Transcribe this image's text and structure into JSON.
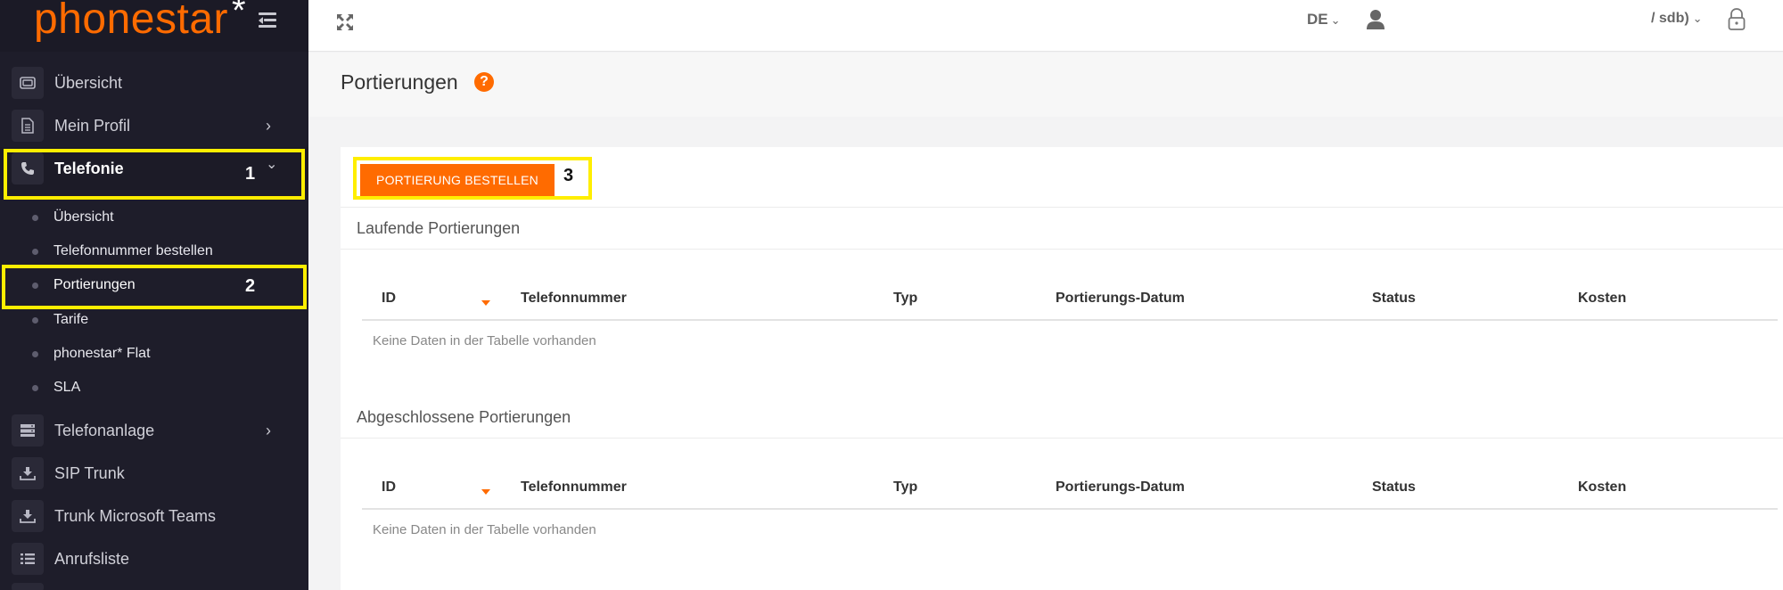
{
  "brand": {
    "logo_text": "phonestar",
    "logo_asterisk": "*"
  },
  "topbar": {
    "lang": "DE",
    "account": "/ sdb)",
    "caret": "⌄"
  },
  "sidebar": {
    "items": [
      {
        "label": "Übersicht",
        "icon": "dashboard-icon"
      },
      {
        "label": "Mein Profil",
        "icon": "document-icon",
        "chevron": "›"
      },
      {
        "label": "Telefonie",
        "icon": "phone-icon",
        "chevron": "⌄",
        "active": true,
        "annotation": "1"
      },
      {
        "label": "Telefonanlage",
        "icon": "server-icon",
        "chevron": "›"
      },
      {
        "label": "SIP Trunk",
        "icon": "download-icon"
      },
      {
        "label": "Trunk Microsoft Teams",
        "icon": "download-icon"
      },
      {
        "label": "Anrufsliste",
        "icon": "list-icon"
      }
    ],
    "sub_items": [
      {
        "label": "Übersicht"
      },
      {
        "label": "Telefonnummer bestellen"
      },
      {
        "label": "Portierungen",
        "active": true,
        "annotation": "2"
      },
      {
        "label": "Tarife"
      },
      {
        "label": "phonestar* Flat"
      },
      {
        "label": "SLA"
      }
    ]
  },
  "page": {
    "title": "Portierungen",
    "help": "?"
  },
  "order_button": {
    "label": "PORTIERUNG BESTELLEN",
    "annotation": "3"
  },
  "tables": [
    {
      "title": "Laufende Portierungen",
      "columns": [
        "ID",
        "Telefonnummer",
        "Typ",
        "Portierungs-Datum",
        "Status",
        "Kosten"
      ],
      "empty_text": "Keine Daten in der Tabelle vorhanden"
    },
    {
      "title": "Abgeschlossene Portierungen",
      "columns": [
        "ID",
        "Telefonnummer",
        "Typ",
        "Portierungs-Datum",
        "Status",
        "Kosten"
      ],
      "empty_text": "Keine Daten in der Tabelle vorhanden"
    }
  ],
  "colors": {
    "accent": "#ff6b00",
    "highlight": "#ffee00",
    "sidebar": "#1e1d2a"
  }
}
